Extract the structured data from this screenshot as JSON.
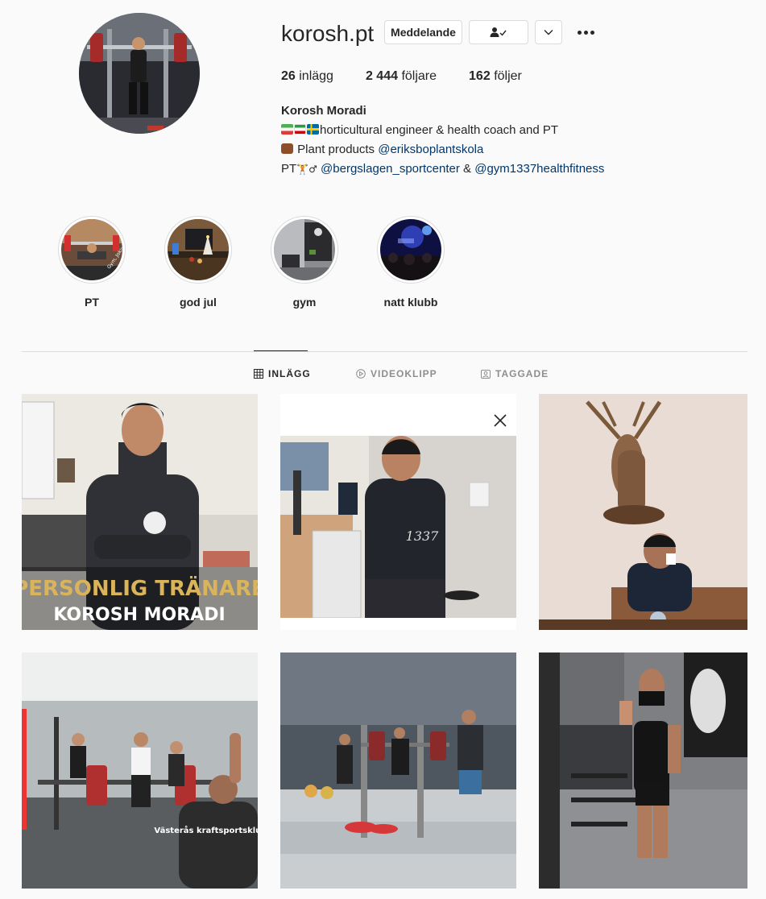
{
  "profile": {
    "username": "korosh.pt",
    "message_label": "Meddelande",
    "stats": {
      "posts_count": "26",
      "posts_label": "inlägg",
      "followers_count": "2 444",
      "followers_label": "följare",
      "following_count": "162",
      "following_label": "följer"
    },
    "bio": {
      "name": "Korosh Moradi",
      "line1": "horticultural engineer & health coach and PT",
      "line2_prefix": "Plant products ",
      "line2_link": "@eriksboplantskola",
      "line3_prefix": "PT",
      "line3_symbols": "🏋♂",
      "line3_link1": "@bergslagen_sportcenter",
      "line3_mid": " & ",
      "line3_link2": "@gym1337healthfitness"
    }
  },
  "highlights": [
    {
      "label": "PT",
      "overlay": "Gym, Joking"
    },
    {
      "label": "god jul"
    },
    {
      "label": "gym"
    },
    {
      "label": "natt klubb"
    }
  ],
  "tabs": [
    {
      "label": "INLÄGG",
      "icon": "grid-icon",
      "active": true
    },
    {
      "label": "VIDEOKLIPP",
      "icon": "play-icon",
      "active": false
    },
    {
      "label": "TAGGADE",
      "icon": "tag-icon",
      "active": false
    }
  ],
  "posts": [
    {
      "overlay_line1": "PERSONLIG TRÄNARE",
      "overlay_line2": "KOROSH MORADI"
    },
    {
      "shirt_text": "1337"
    },
    {},
    {
      "shirt_text": "Västerås kraftsportsklubb"
    },
    {},
    {}
  ],
  "colors": {
    "link": "#00376b",
    "border": "#dbdbdb",
    "text": "#262626",
    "muted": "#8e8e8e",
    "gold": "#d9b45a"
  }
}
